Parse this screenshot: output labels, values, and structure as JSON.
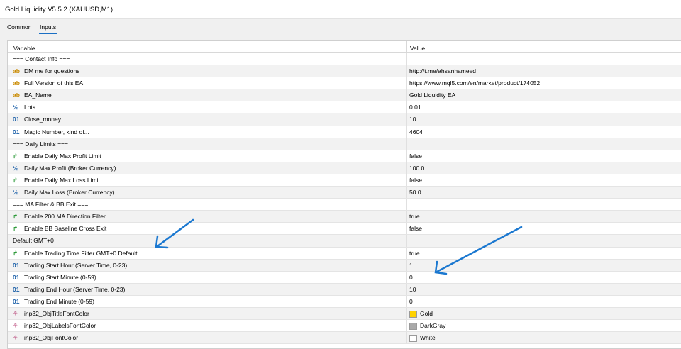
{
  "window": {
    "title": "Gold Liquidity V5 5.2 (XAUUSD,M1)"
  },
  "tabs": [
    {
      "label": "Common"
    },
    {
      "label": "Inputs"
    }
  ],
  "table": {
    "headers": {
      "variable": "Variable",
      "value": "Value"
    },
    "rows": [
      {
        "icon": "section",
        "variable": "=== Contact Info ===",
        "value": ""
      },
      {
        "icon": "string-icon",
        "variable": "DM me for questions",
        "value": "http://t.me/ahsanhameed"
      },
      {
        "icon": "string-icon",
        "variable": "Full Version of this EA",
        "value": "https://www.mql5.com/en/market/product/174052"
      },
      {
        "icon": "string-icon",
        "variable": "EA_Name",
        "value": "Gold Liquidity EA"
      },
      {
        "icon": "double-icon",
        "variable": "Lots",
        "value": "0.01"
      },
      {
        "icon": "integer-icon",
        "variable": "Close_money",
        "value": "10"
      },
      {
        "icon": "integer-icon",
        "variable": "Magic Number, kind of...",
        "value": "4604"
      },
      {
        "icon": "section",
        "variable": "=== Daily Limits ===",
        "value": ""
      },
      {
        "icon": "bool-icon",
        "variable": "Enable Daily Max Profit Limit",
        "value": "false"
      },
      {
        "icon": "double-icon",
        "variable": "Daily Max Profit (Broker Currency)",
        "value": "100.0"
      },
      {
        "icon": "bool-icon",
        "variable": "Enable Daily Max Loss Limit",
        "value": "false"
      },
      {
        "icon": "double-icon",
        "variable": "Daily Max Loss (Broker Currency)",
        "value": "50.0"
      },
      {
        "icon": "section",
        "variable": "=== MA Filter & BB Exit ===",
        "value": ""
      },
      {
        "icon": "bool-icon",
        "variable": "Enable 200 MA Direction Filter",
        "value": "true"
      },
      {
        "icon": "bool-icon",
        "variable": "Enable BB Baseline Cross Exit",
        "value": "false"
      },
      {
        "icon": "section",
        "variable": "Default GMT+0",
        "value": ""
      },
      {
        "icon": "bool-icon",
        "variable": "Enable Trading Time Filter GMT+0 Default",
        "value": "true"
      },
      {
        "icon": "integer-icon",
        "variable": "Trading Start Hour (Server Time, 0-23)",
        "value": "1"
      },
      {
        "icon": "integer-icon",
        "variable": "Trading Start Minute (0-59)",
        "value": "0"
      },
      {
        "icon": "integer-icon",
        "variable": "Trading End Hour (Server Time, 0-23)",
        "value": "10"
      },
      {
        "icon": "integer-icon",
        "variable": "Trading End Minute (0-59)",
        "value": "0"
      },
      {
        "icon": "color-icon",
        "variable": "inp32_ObjTitleFontColor",
        "value": "Gold",
        "swatch": "#ffd200"
      },
      {
        "icon": "color-icon",
        "variable": "inp32_ObjLabelsFontColor",
        "value": "DarkGray",
        "swatch": "#a9a9a9"
      },
      {
        "icon": "color-icon",
        "variable": "inp32_ObjFontColor",
        "value": "White",
        "swatch": "#ffffff"
      }
    ]
  },
  "colors": {
    "accent": "#1a6fc4",
    "arrow": "#1b78d0"
  }
}
